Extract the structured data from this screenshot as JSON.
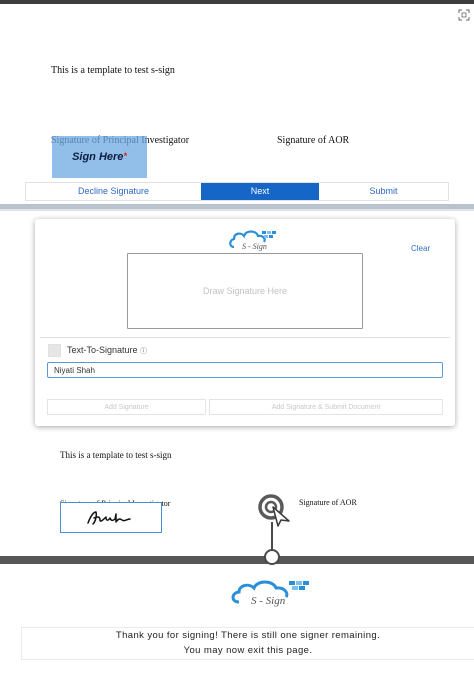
{
  "panel1": {
    "template_text": "This is a template to test s-sign",
    "sig_pi_label": "Signature of Principal Investigator",
    "sig_aor_label": "Signature of AOR",
    "sign_here": "Sign Here",
    "required_mark": "*",
    "buttons": {
      "decline": "Decline Signature",
      "next": "Next",
      "submit": "Submit"
    }
  },
  "modal": {
    "logo_text": "S - Sign",
    "clear_label": "Clear",
    "canvas_placeholder": "Draw Signature Here",
    "text_to_signature_label": "Text-To-Signature",
    "info_glyph": "ⓘ",
    "name_input_value": "Niyati Shah",
    "add_signature_label": "Add Signature",
    "add_and_submit_label": "Add Signature & Submit Document"
  },
  "panel3": {
    "template_text": "This is a template to test s-sign",
    "sig_pi_label": "Signature of Principal Investigator",
    "sig_aor_label": "Signature of AOR"
  },
  "panel4": {
    "logo_text": "S - Sign",
    "message_line1": "Thank you for signing! There is still one signer remaining.",
    "message_line2": "You may now exit this page."
  },
  "colors": {
    "primary_blue": "#1566c7",
    "link_blue": "#2e67c4",
    "highlight_blue": "#6eaae1",
    "required_red": "#e02020"
  },
  "icons": {
    "expand": "expand-icon",
    "info": "info-icon",
    "cursor": "refresh-cursor-icon",
    "logo": "cloud-logo"
  }
}
